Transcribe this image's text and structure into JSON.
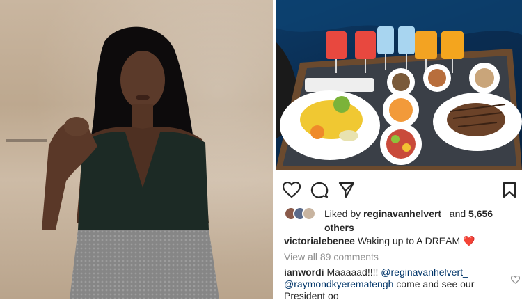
{
  "post": {
    "likes_prefix": "Liked by ",
    "likes_user": "reginavanhelvert_",
    "likes_and": " and ",
    "likes_count": "5,656",
    "likes_suffix": "others",
    "caption_user": "victorialebenee",
    "caption_text": " Waking up to A DREAM ",
    "caption_emoji": "❤️",
    "view_all_comments": "View all 89 comments"
  },
  "comment": {
    "user": "ianwordi",
    "text_1": " Maaaaad!!!! ",
    "mention_1": "@reginavanhelvert_",
    "mention_2": "@raymondkyerematengh",
    "text_2": " come and see our President oo"
  },
  "icons": {
    "like": "heart-icon",
    "comment": "comment-icon",
    "share": "share-icon",
    "save": "bookmark-icon"
  },
  "colors": {
    "text": "#262626",
    "muted": "#8e8e8e",
    "mention": "#003569",
    "heart": "#e0202d"
  }
}
